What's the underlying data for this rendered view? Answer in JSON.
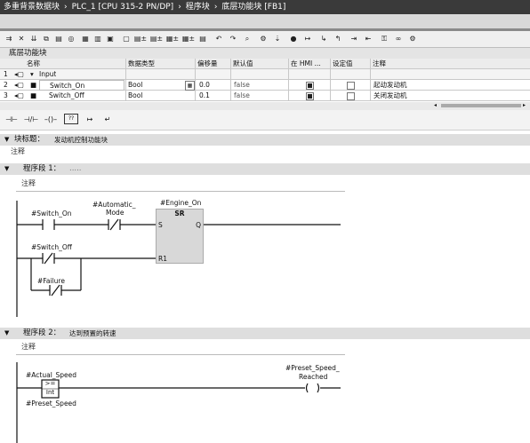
{
  "breadcrumb": [
    "多重背景数据块",
    "PLC_1 [CPU 315-2 PN/DP]",
    "程序块",
    "底层功能块 [FB1]"
  ],
  "interface": {
    "title": "底层功能块",
    "columns": [
      "名称",
      "数据类型",
      "偏移量",
      "默认值",
      "在 HMI ...",
      "设定值",
      "注释"
    ],
    "rows": [
      {
        "num": "1",
        "name": "Input",
        "type": "",
        "offset": "",
        "default": "",
        "hmi": false,
        "setpoint": false,
        "comment": ""
      },
      {
        "num": "2",
        "name": "Switch_On",
        "type": "Bool",
        "offset": "0.0",
        "default": "false",
        "hmi": true,
        "setpoint": false,
        "comment": "起动发动机"
      },
      {
        "num": "3",
        "name": "Switch_Off",
        "type": "Bool",
        "offset": "0.1",
        "default": "false",
        "hmi": true,
        "setpoint": false,
        "comment": "关闭发动机"
      }
    ]
  },
  "block": {
    "title_label": "块标题：",
    "title_value": "发动机控制功能块",
    "comment": "注释"
  },
  "networks": [
    {
      "label": "程序段 1：",
      "title": ".....",
      "comment": "注释",
      "contacts": {
        "switch_on": "#Switch_On",
        "automatic_mode_1": "#Automatic_",
        "automatic_mode_2": "Mode",
        "switch_off": "#Switch_Off",
        "failure": "#Failure"
      },
      "block": {
        "instance": "#Engine_On",
        "type": "SR",
        "pin_s": "S",
        "pin_r1": "R1",
        "pin_q": "Q"
      }
    },
    {
      "label": "程序段 2：",
      "title": "达到预置的转速",
      "comment": "注释",
      "compare": {
        "in1": "#Actual_Speed",
        "op": ">=",
        "type": "Int",
        "in2": "#Preset_Speed"
      },
      "coil": {
        "line1": "#Preset_Speed_",
        "line2": "Reached"
      }
    }
  ]
}
